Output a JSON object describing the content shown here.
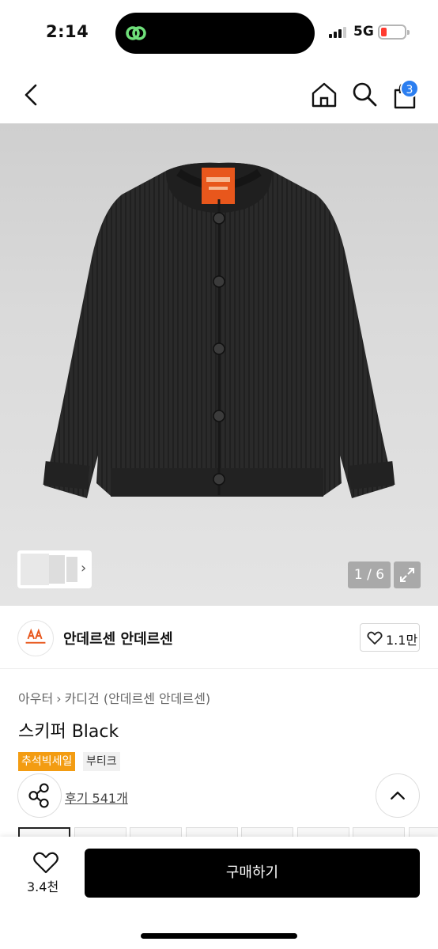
{
  "status": {
    "time": "2:14",
    "network": "5G"
  },
  "nav": {
    "cart_count": "3"
  },
  "gallery": {
    "counter": "1 / 6",
    "thumb_arrow": "›"
  },
  "brand": {
    "name": "안데르센 안데르센",
    "likes": "1.1만"
  },
  "product": {
    "breadcrumb": [
      "아우터",
      "카디건 (안데르센 안데르센)"
    ],
    "breadcrumb_sep": "›",
    "title": "스키퍼 Black",
    "tags": [
      "추석빅세일",
      "부티크"
    ],
    "review_link": "후기 541개"
  },
  "bottom": {
    "wish_count": "3.4천",
    "buy_label": "구매하기"
  },
  "colors": {
    "accent": "#f39c12",
    "badge": "#2b7ef0",
    "buy": "#000000"
  }
}
